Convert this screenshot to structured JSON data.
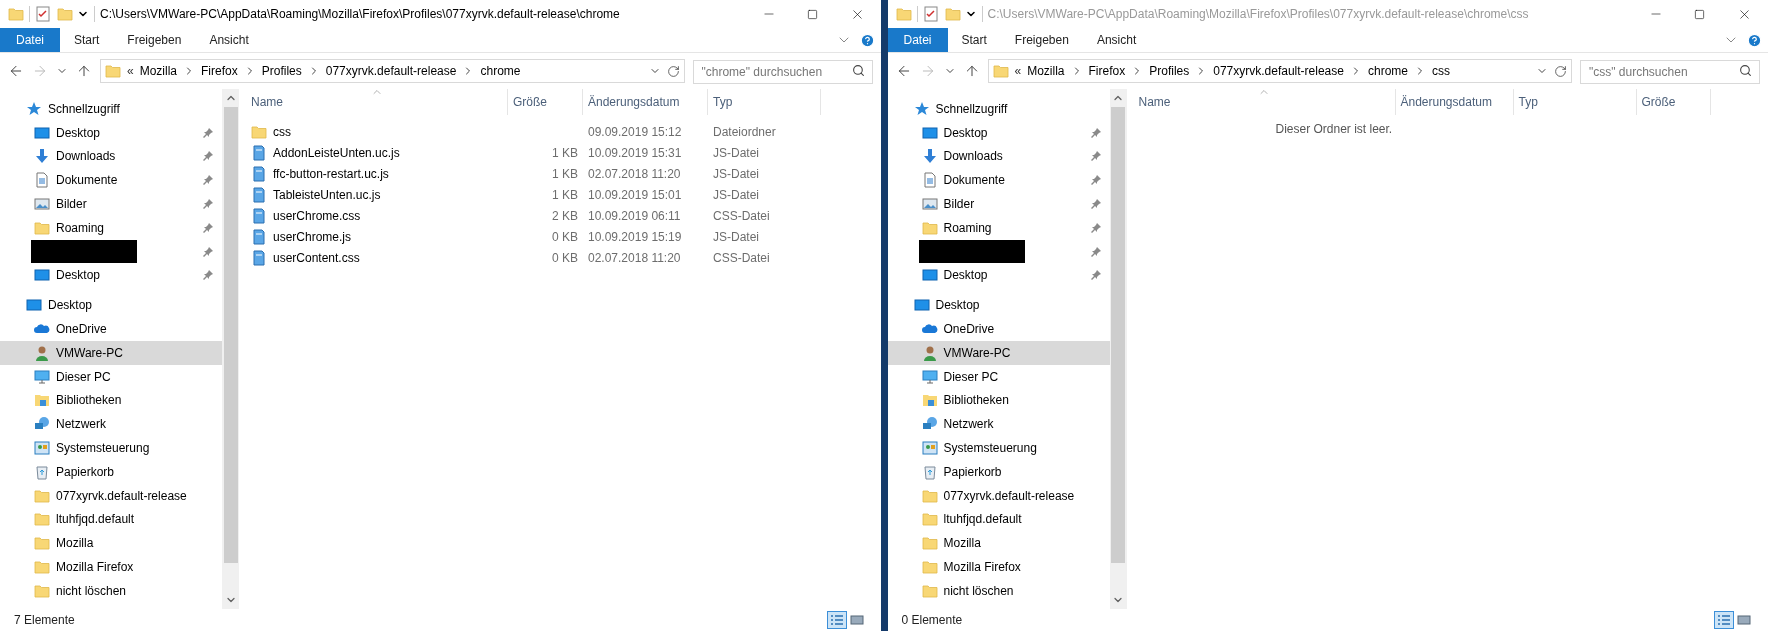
{
  "windows": [
    {
      "active": true,
      "title": "C:\\Users\\VMWare-PC\\AppData\\Roaming\\Mozilla\\Firefox\\Profiles\\077xyrvk.default-release\\chrome",
      "ribbon_tabs": [
        {
          "label": "Datei",
          "kind": "file"
        },
        {
          "label": "Start",
          "kind": "tab"
        },
        {
          "label": "Freigeben",
          "kind": "tab"
        },
        {
          "label": "Ansicht",
          "kind": "tab"
        }
      ],
      "address": {
        "overflow": "«",
        "segments": [
          "Mozilla",
          "Firefox",
          "Profiles",
          "077xyrvk.default-release",
          "chrome"
        ]
      },
      "search": {
        "placeholder": "\"chrome\" durchsuchen"
      },
      "nav": [
        {
          "label": "Schnellzugriff",
          "kind": "star",
          "selected": false,
          "children": [
            {
              "label": "Desktop",
              "kind": "desktop",
              "selected": false,
              "pinned": true
            },
            {
              "label": "Downloads",
              "kind": "download",
              "selected": false,
              "pinned": true
            },
            {
              "label": "Dokumente",
              "kind": "document",
              "selected": false,
              "pinned": true
            },
            {
              "label": "Bilder",
              "kind": "pictures",
              "selected": false,
              "pinned": true
            },
            {
              "label": "Roaming",
              "kind": "folder",
              "selected": false,
              "pinned": true
            },
            {
              "kind": "redacted",
              "selected": false,
              "pinned": true
            },
            {
              "label": "Desktop",
              "kind": "desktop",
              "selected": false,
              "pinned": true
            }
          ]
        },
        {
          "label": "Desktop",
          "kind": "desktop",
          "selected": false,
          "children": [
            {
              "label": "OneDrive",
              "kind": "cloud",
              "selected": false
            },
            {
              "label": "VMWare-PC",
              "kind": "user",
              "selected": true
            },
            {
              "label": "Dieser PC",
              "kind": "pc",
              "selected": false
            },
            {
              "label": "Bibliotheken",
              "kind": "library",
              "selected": false
            },
            {
              "label": "Netzwerk",
              "kind": "network",
              "selected": false
            },
            {
              "label": "Systemsteuerung",
              "kind": "control",
              "selected": false
            },
            {
              "label": "Papierkorb",
              "kind": "recycle",
              "selected": false
            },
            {
              "label": "077xyrvk.default-release",
              "kind": "folder",
              "selected": false
            },
            {
              "label": "ltuhfjqd.default",
              "kind": "folder",
              "selected": false
            },
            {
              "label": "Mozilla",
              "kind": "folder",
              "selected": false
            },
            {
              "label": "Mozilla Firefox",
              "kind": "folder",
              "selected": false
            },
            {
              "label": "nicht löschen",
              "kind": "folder",
              "selected": false
            }
          ]
        }
      ],
      "columns": [
        {
          "label": "Name",
          "kind": "name",
          "sorted": true
        },
        {
          "label": "Größe",
          "kind": "size",
          "sorted": false
        },
        {
          "label": "Änderungsdatum",
          "kind": "date",
          "sorted": false
        },
        {
          "label": "Typ",
          "kind": "type",
          "sorted": false
        }
      ],
      "rows": [
        {
          "kind": "folder",
          "name": "css",
          "date": "09.09.2019 15:12",
          "type": "Dateiordner"
        },
        {
          "kind": "script",
          "name": "AddonLeisteUnten.uc.js",
          "size": "1 KB",
          "date": "10.09.2019 15:31",
          "type": "JS-Datei"
        },
        {
          "kind": "script",
          "name": "ffc-button-restart.uc.js",
          "size": "1 KB",
          "date": "02.07.2018 11:20",
          "type": "JS-Datei"
        },
        {
          "kind": "script",
          "name": "TableisteUnten.uc.js",
          "size": "1 KB",
          "date": "10.09.2019 15:01",
          "type": "JS-Datei"
        },
        {
          "kind": "script",
          "name": "userChrome.css",
          "size": "2 KB",
          "date": "10.09.2019 06:11",
          "type": "CSS-Datei"
        },
        {
          "kind": "script",
          "name": "userChrome.js",
          "size": "0 KB",
          "date": "10.09.2019 15:19",
          "type": "JS-Datei"
        },
        {
          "kind": "script",
          "name": "userContent.css",
          "size": "0 KB",
          "date": "02.07.2018 11:20",
          "type": "CSS-Datei"
        }
      ],
      "status": "7 Elemente",
      "views": [
        {
          "kind": "details",
          "selected": true
        },
        {
          "kind": "tiles",
          "selected": false
        }
      ]
    },
    {
      "active": false,
      "title": "C:\\Users\\VMWare-PC\\AppData\\Roaming\\Mozilla\\Firefox\\Profiles\\077xyrvk.default-release\\chrome\\css",
      "ribbon_tabs": [
        {
          "label": "Datei",
          "kind": "file"
        },
        {
          "label": "Start",
          "kind": "tab"
        },
        {
          "label": "Freigeben",
          "kind": "tab"
        },
        {
          "label": "Ansicht",
          "kind": "tab"
        }
      ],
      "address": {
        "overflow": "«",
        "segments": [
          "Mozilla",
          "Firefox",
          "Profiles",
          "077xyrvk.default-release",
          "chrome",
          "css"
        ]
      },
      "search": {
        "placeholder": "\"css\" durchsuchen"
      },
      "nav": [
        {
          "label": "Schnellzugriff",
          "kind": "star",
          "selected": false,
          "children": [
            {
              "label": "Desktop",
              "kind": "desktop",
              "selected": false,
              "pinned": true
            },
            {
              "label": "Downloads",
              "kind": "download",
              "selected": false,
              "pinned": true
            },
            {
              "label": "Dokumente",
              "kind": "document",
              "selected": false,
              "pinned": true
            },
            {
              "label": "Bilder",
              "kind": "pictures",
              "selected": false,
              "pinned": true
            },
            {
              "label": "Roaming",
              "kind": "folder",
              "selected": false,
              "pinned": true
            },
            {
              "kind": "redacted",
              "selected": false,
              "pinned": true
            },
            {
              "label": "Desktop",
              "kind": "desktop",
              "selected": false,
              "pinned": true
            }
          ]
        },
        {
          "label": "Desktop",
          "kind": "desktop",
          "selected": false,
          "children": [
            {
              "label": "OneDrive",
              "kind": "cloud",
              "selected": false
            },
            {
              "label": "VMWare-PC",
              "kind": "user",
              "selected": true
            },
            {
              "label": "Dieser PC",
              "kind": "pc",
              "selected": false
            },
            {
              "label": "Bibliotheken",
              "kind": "library",
              "selected": false
            },
            {
              "label": "Netzwerk",
              "kind": "network",
              "selected": false
            },
            {
              "label": "Systemsteuerung",
              "kind": "control",
              "selected": false
            },
            {
              "label": "Papierkorb",
              "kind": "recycle",
              "selected": false
            },
            {
              "label": "077xyrvk.default-release",
              "kind": "folder",
              "selected": false
            },
            {
              "label": "ltuhfjqd.default",
              "kind": "folder",
              "selected": false
            },
            {
              "label": "Mozilla",
              "kind": "folder",
              "selected": false
            },
            {
              "label": "Mozilla Firefox",
              "kind": "folder",
              "selected": false
            },
            {
              "label": "nicht löschen",
              "kind": "folder",
              "selected": false
            }
          ]
        }
      ],
      "columns": [
        {
          "label": "Name",
          "kind": "name",
          "sorted": true
        },
        {
          "label": "Änderungsdatum",
          "kind": "date",
          "sorted": false
        },
        {
          "label": "Typ",
          "kind": "type",
          "sorted": false
        },
        {
          "label": "Größe",
          "kind": "size",
          "sorted": false
        }
      ],
      "empty_message": "Dieser Ordner ist leer.",
      "status": "0 Elemente",
      "views": [
        {
          "kind": "details",
          "selected": true
        },
        {
          "kind": "tiles",
          "selected": false
        }
      ]
    }
  ]
}
